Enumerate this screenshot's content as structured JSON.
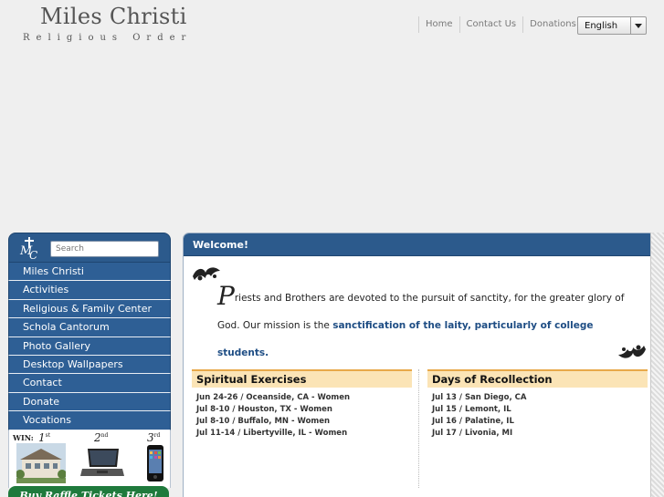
{
  "header": {
    "logo_title": "Miles Christi",
    "logo_subtitle": "Religious Order",
    "nav": [
      "Home",
      "Contact Us",
      "Donations"
    ],
    "language": "English"
  },
  "sidebar": {
    "logo_text": "MC",
    "search_placeholder": "Search",
    "items": [
      "Miles Christi",
      "Activities",
      "Religious & Family Center",
      "Schola Cantorum",
      "Photo Gallery",
      "Desktop Wallpapers",
      "Contact",
      "Donate",
      "Vocations"
    ],
    "promo": {
      "win": "WIN:",
      "places": [
        "1st",
        "2nd",
        "3rd"
      ]
    },
    "raffle": "Buy Raffle Tickets Here!"
  },
  "main": {
    "title": "Welcome!",
    "intro_dropcap": "P",
    "intro_text": "riests and Brothers are devoted to the pursuit of sanctity, for the greater glory of God. Our mission is the",
    "intro_highlight": "sanctification of the laity, particularly of college students.",
    "spiritual": {
      "title": "Spiritual Exercises",
      "items": [
        "Jun 24-26 / Oceanside, CA - Women",
        "Jul 8-10 / Houston, TX - Women",
        "Jul 8-10 / Buffalo, MN - Women",
        "Jul 11-14 / Libertyville, IL - Women"
      ]
    },
    "recollection": {
      "title": "Days of Recollection",
      "items": [
        "Jul 13 / San Diego, CA",
        "Jul 15 / Lemont, IL",
        "Jul 16 / Palatine, IL",
        "Jul 17 / Livonia, MI"
      ]
    }
  },
  "colors": {
    "nav_blue": "#2e5f95",
    "header_blue": "#2c5a8c",
    "highlight_blue": "#1e4d84",
    "event_header_bg": "#fbe4b6",
    "event_header_border": "#e8a94a",
    "raffle_green": "#1f7a3c"
  }
}
